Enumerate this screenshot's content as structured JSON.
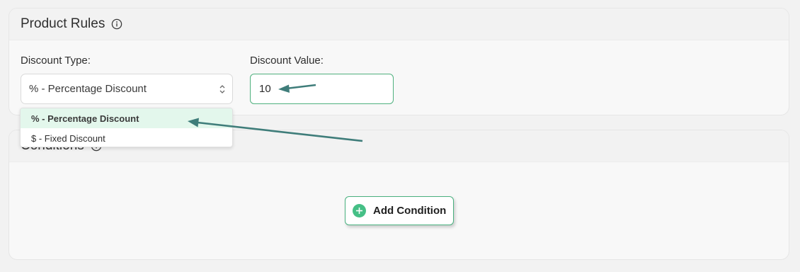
{
  "product_rules": {
    "title": "Product Rules",
    "discount_type_label": "Discount Type:",
    "discount_type_selected": "% - Percentage Discount",
    "discount_value_label": "Discount Value:",
    "discount_value": "10",
    "options": [
      "% - Percentage Discount",
      "$ - Fixed Discount"
    ]
  },
  "conditions": {
    "title": "Conditions",
    "add_button_label": "Add Condition"
  },
  "colors": {
    "accent": "#4fb07e",
    "annotation_arrow": "#3f7d7a"
  }
}
